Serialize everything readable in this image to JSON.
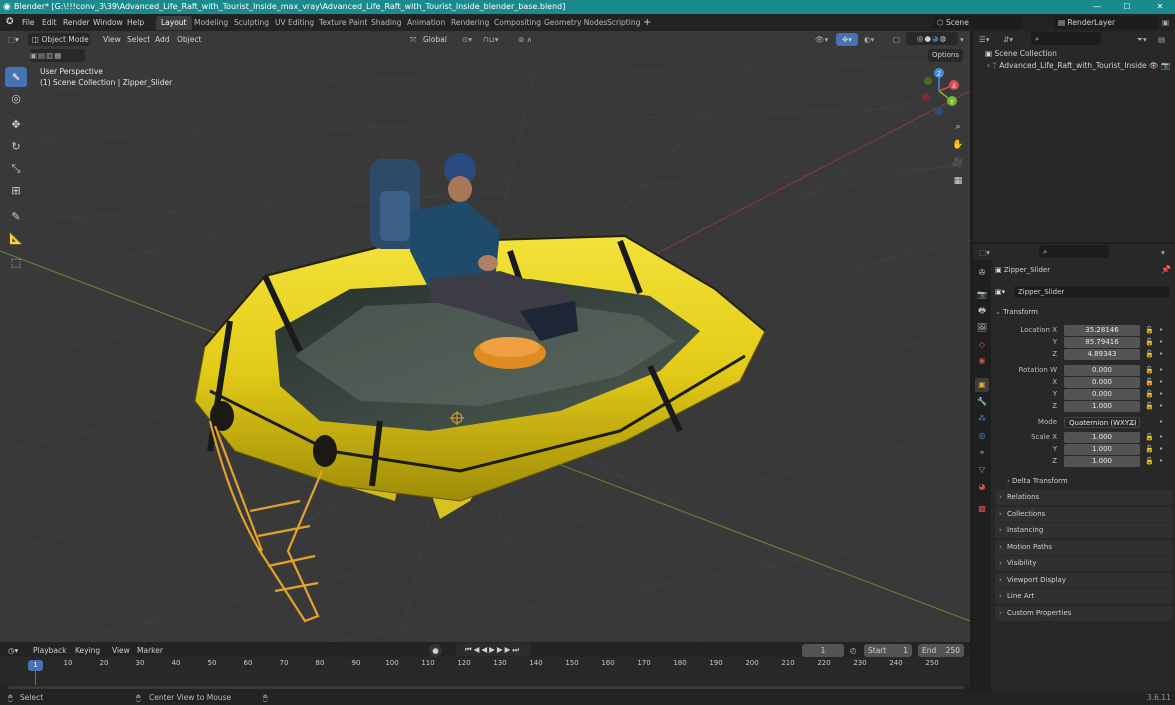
{
  "title_bar": {
    "title": "Blender* [G:\\!!!conv_3\\39\\Advanced_Life_Raft_with_Tourist_Inside_max_vray\\Advanced_Life_Raft_with_Tourist_Inside_blender_base.blend]",
    "minimize": "—",
    "maximize": "☐",
    "close": "✕"
  },
  "menu": {
    "file": "File",
    "edit": "Edit",
    "render": "Render",
    "window": "Window",
    "help": "Help"
  },
  "workspaces": [
    "Layout",
    "Modeling",
    "Sculpting",
    "UV Editing",
    "Texture Paint",
    "Shading",
    "Animation",
    "Rendering",
    "Compositing",
    "Geometry Nodes",
    "Scripting"
  ],
  "workspace_add": "+",
  "scene": {
    "name": "Scene",
    "render_layer": "RenderLayer"
  },
  "viewport": {
    "mode": "Object Mode",
    "menus": {
      "view": "View",
      "select": "Select",
      "add": "Add",
      "object": "Object"
    },
    "orientation": "Global",
    "options": "Options",
    "info_line1": "User Perspective",
    "info_line2": "(1) Scene Collection | Zipper_Slider",
    "gizmo": {
      "x": "X",
      "y": "Y",
      "z": "Z"
    }
  },
  "outliner": {
    "root": "Scene Collection",
    "item": "Advanced_Life_Raft_with_Tourist_Inside"
  },
  "properties": {
    "object_name": "Zipper_Slider",
    "data_name": "Zipper_Slider",
    "transform_header": "Transform",
    "location_label": "Location X",
    "location": {
      "x": "35.28146",
      "y": "85.79416",
      "z": "4.89343"
    },
    "rotation_label": "Rotation W",
    "rotation": {
      "w": "0.000",
      "x": "0.000",
      "y": "0.000",
      "z": "1.000"
    },
    "mode_label": "Mode",
    "mode_value": "Quaternion (WXYZ)",
    "scale_label": "Scale X",
    "scale": {
      "x": "1.000",
      "y": "1.000",
      "z": "1.000"
    },
    "axis_y": "Y",
    "axis_z": "Z",
    "axis_x": "X",
    "delta_transform": "Delta Transform",
    "panels": [
      "Relations",
      "Collections",
      "Instancing",
      "Motion Paths",
      "Visibility",
      "Viewport Display",
      "Line Art",
      "Custom Properties"
    ]
  },
  "timeline": {
    "menus": {
      "playback": "Playback",
      "keying": "Keying",
      "view": "View",
      "marker": "Marker"
    },
    "current_frame": "1",
    "start_label": "Start",
    "start": "1",
    "end_label": "End",
    "end": "250",
    "ticks": [
      "10",
      "20",
      "30",
      "40",
      "50",
      "60",
      "70",
      "80",
      "90",
      "100",
      "110",
      "120",
      "130",
      "140",
      "150",
      "160",
      "170",
      "180",
      "190",
      "200",
      "210",
      "220",
      "230",
      "240",
      "250"
    ],
    "playhead": "1"
  },
  "status": {
    "select": "Select",
    "center_view": "Center View to Mouse",
    "version": "3.6.11"
  },
  "colors": {
    "accent": "#4772b3",
    "title_bar": "#1b8a8f",
    "raft_yellow": "#e8d21a",
    "active_object": "#e8a23a"
  }
}
